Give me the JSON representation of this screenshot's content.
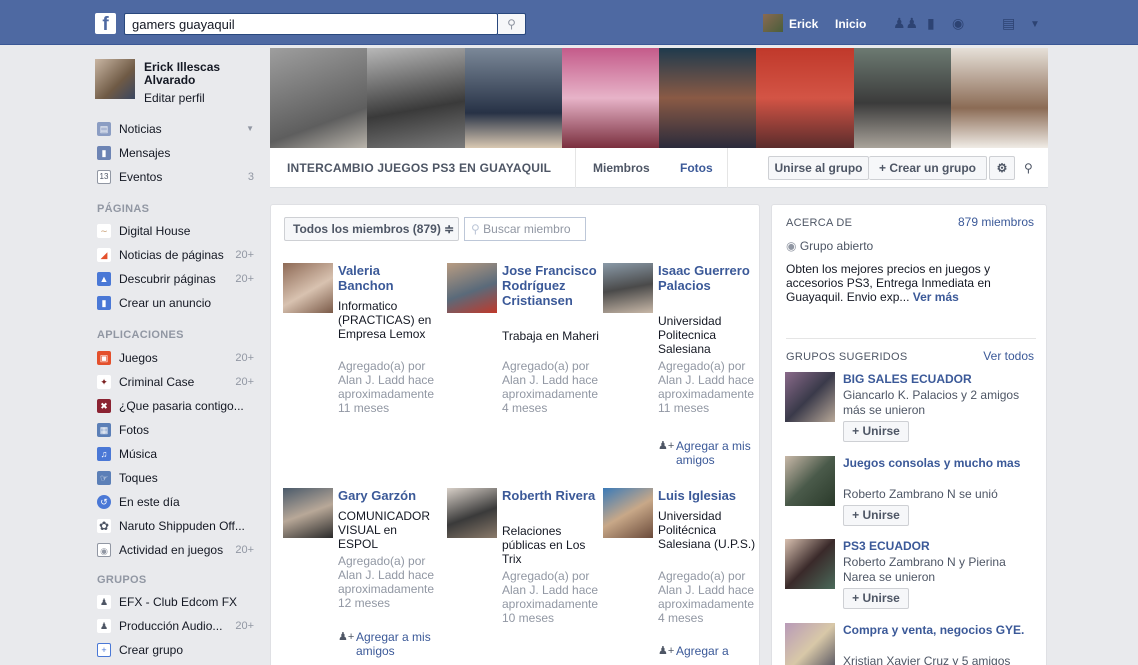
{
  "topbar": {
    "search_value": "gamers guayaquil",
    "user_name": "Erick",
    "home_label": "Inicio"
  },
  "sidebar": {
    "profile_name": "Erick Illescas Alvarado",
    "edit_profile": "Editar perfil",
    "favorites": [
      {
        "label": "Noticias",
        "count": ""
      },
      {
        "label": "Mensajes",
        "count": ""
      },
      {
        "label": "Eventos",
        "count": "3",
        "icon_text": "13"
      }
    ],
    "pages_header": "PÁGINAS",
    "pages": [
      {
        "label": "Digital House",
        "count": ""
      },
      {
        "label": "Noticias de páginas",
        "count": "20+"
      },
      {
        "label": "Descubrir páginas",
        "count": "20+"
      },
      {
        "label": "Crear un anuncio",
        "count": ""
      }
    ],
    "apps_header": "APLICACIONES",
    "apps": [
      {
        "label": "Juegos",
        "count": "20+"
      },
      {
        "label": "Criminal Case",
        "count": "20+"
      },
      {
        "label": "¿Que pasaria contigo...",
        "count": ""
      },
      {
        "label": "Fotos",
        "count": ""
      },
      {
        "label": "Música",
        "count": ""
      },
      {
        "label": "Toques",
        "count": ""
      },
      {
        "label": "En este día",
        "count": ""
      },
      {
        "label": "Naruto Shippuden Off...",
        "count": ""
      },
      {
        "label": "Actividad en juegos",
        "count": "20+"
      }
    ],
    "groups_header": "GRUPOS",
    "groups": [
      {
        "label": "EFX - Club Edcom FX",
        "count": ""
      },
      {
        "label": "Producción Audio...",
        "count": "20+"
      },
      {
        "label": "Crear grupo",
        "count": ""
      }
    ]
  },
  "group": {
    "title": "INTERCAMBIO JUEGOS PS3 EN GUAYAQUIL",
    "tab_members": "Miembros",
    "tab_photos": "Fotos",
    "join_button": "Unirse al grupo",
    "create_button": "+ Crear un grupo"
  },
  "members_panel": {
    "filter_label": "Todos los miembros (879) ≑",
    "search_placeholder": "Buscar miembro",
    "members": [
      {
        "name": "Valeria Banchon",
        "details": "Informatico (PRACTICAS) en Empresa Lemox",
        "added": "Agregado(a) por Alan J. Ladd hace aproximadamente 11 meses",
        "button": ""
      },
      {
        "name": "Jose Francisco Rodríguez Cristiansen",
        "details": "Trabaja en Maheri",
        "added": "Agregado(a) por Alan J. Ladd hace aproximadamente 4 meses",
        "button": ""
      },
      {
        "name": "Isaac Guerrero Palacios",
        "details": "Universidad Politecnica Salesiana",
        "added": "Agregado(a) por Alan J. Ladd hace aproximadamente 11 meses",
        "button": "Agregar a mis amigos"
      },
      {
        "name": "Gary Garzón",
        "details": "COMUNICADOR VISUAL en ESPOL",
        "added": "Agregado(a) por Alan J. Ladd hace aproximadamente 12 meses",
        "button": "Agregar a mis amigos"
      },
      {
        "name": "Roberth Rivera",
        "details": "Relaciones públicas en Los Trix",
        "added": "Agregado(a) por Alan J. Ladd hace aproximadamente 10 meses",
        "button": ""
      },
      {
        "name": "Luis Iglesias",
        "details": "Universidad Politécnica Salesiana (U.P.S.)",
        "added": "Agregado(a) por Alan J. Ladd hace aproximadamente 4 meses",
        "button": "Agregar a"
      }
    ]
  },
  "about": {
    "label": "ACERCA DE",
    "members_count": "879 miembros",
    "privacy": "Grupo abierto",
    "description": "Obten los mejores precios en juegos y accesorios PS3, Entrega Inmediata en Guayaquil. Envio exp...",
    "more": "Ver más"
  },
  "suggested": {
    "label": "GRUPOS SUGERIDOS",
    "see_all": "Ver todos",
    "groups": [
      {
        "name": "BIG SALES ECUADOR",
        "sub": "Giancarlo K. Palacios y 2 amigos más se unieron",
        "button": "+ Unirse"
      },
      {
        "name": "Juegos consolas y mucho mas",
        "sub": "Roberto Zambrano N se unió",
        "button": "+ Unirse"
      },
      {
        "name": "PS3 ECUADOR",
        "sub": "Roberto Zambrano N y Pierina Narea se unieron",
        "button": "+ Unirse"
      },
      {
        "name": "Compra y venta, negocios GYE.",
        "sub": "Xristian Xavier Cruz y 5 amigos",
        "button": ""
      }
    ]
  }
}
